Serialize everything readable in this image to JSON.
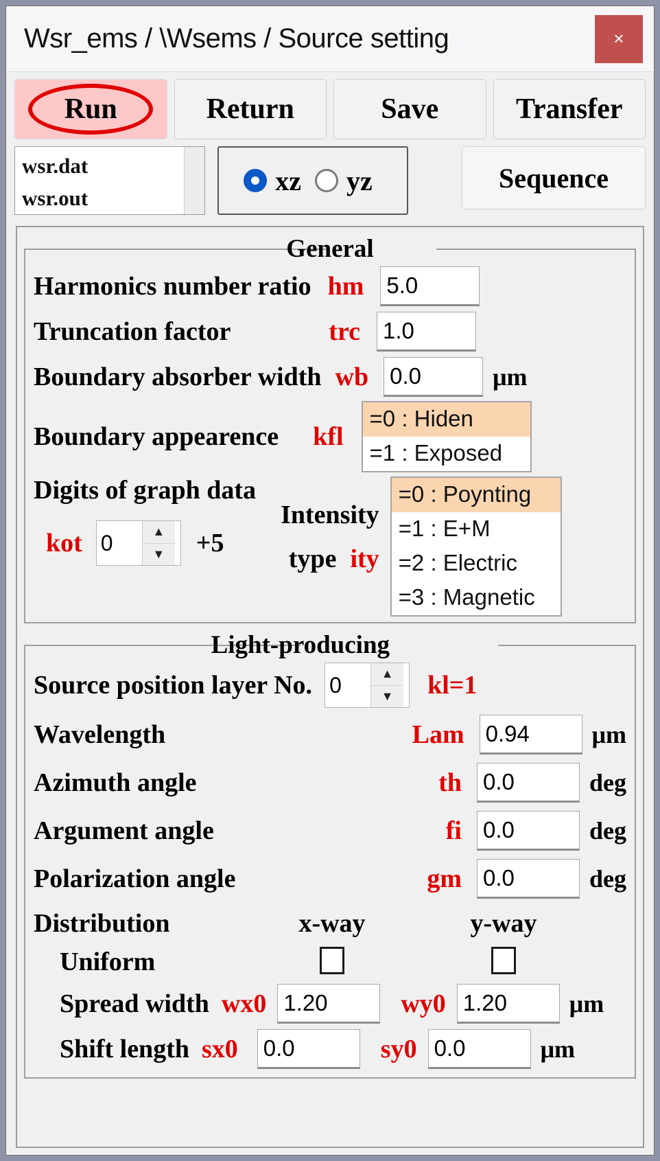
{
  "window": {
    "title": "Wsr_ems / \\Wsems / Source setting",
    "close_label": "×"
  },
  "toolbar": {
    "run_label": "Run",
    "return_label": "Return",
    "save_label": "Save",
    "transfer_label": "Transfer",
    "run_highlight_color": "#ffc8c8",
    "run_annotation_color": "#e00000"
  },
  "files": {
    "items": [
      "wsr.dat",
      "wsr.out"
    ]
  },
  "plane": {
    "options": [
      "xz",
      "yz"
    ],
    "selected": "xz",
    "xz_label": "xz",
    "yz_label": "yz"
  },
  "sequence": {
    "label": "Sequence"
  },
  "general": {
    "legend": "General",
    "harmonics": {
      "label": "Harmonics number ratio",
      "var": "hm",
      "value": "5.0"
    },
    "truncation": {
      "label": "Truncation factor",
      "var": "trc",
      "value": "1.0"
    },
    "absorber": {
      "label": "Boundary absorber width",
      "var": "wb",
      "value": "0.0",
      "unit": "μm"
    },
    "appearance": {
      "label": "Boundary appearence",
      "var": "kfl",
      "options": [
        "=0 : Hiden",
        "=1 : Exposed"
      ],
      "selected_index": 0
    },
    "digits": {
      "label": "Digits of graph data",
      "var": "kot",
      "value": "0",
      "suffix": "+5"
    },
    "intensity": {
      "label_line1": "Intensity",
      "label_line2": "type",
      "var": "ity",
      "options": [
        "=0 : Poynting",
        "=1 : E+M",
        "=2 : Electric",
        "=3 : Magnetic"
      ],
      "selected_index": 0
    }
  },
  "light": {
    "legend": "Light-producing",
    "source_layer": {
      "label": "Source position layer No.",
      "value": "0",
      "note": "kl=1"
    },
    "wavelength": {
      "label": "Wavelength",
      "var": "Lam",
      "value": "0.94",
      "unit": "μm"
    },
    "azimuth": {
      "label": "Azimuth angle",
      "var": "th",
      "value": "0.0",
      "unit": "deg"
    },
    "argument": {
      "label": "Argument angle",
      "var": "fi",
      "value": "0.0",
      "unit": "deg"
    },
    "polarization": {
      "label": "Polarization angle",
      "var": "gm",
      "value": "0.0",
      "unit": "deg"
    },
    "distribution": {
      "label": "Distribution",
      "x_header": "x-way",
      "y_header": "y-way",
      "uniform": {
        "label": "Uniform",
        "x_checked": false,
        "y_checked": false
      },
      "spread": {
        "label": "Spread width",
        "x_var": "wx0",
        "x_value": "1.20",
        "y_var": "wy0",
        "y_value": "1.20",
        "unit": "μm"
      },
      "shift": {
        "label": "Shift length",
        "x_var": "sx0",
        "x_value": "0.0",
        "y_var": "sy0",
        "y_value": "0.0",
        "unit": "μm"
      }
    }
  }
}
